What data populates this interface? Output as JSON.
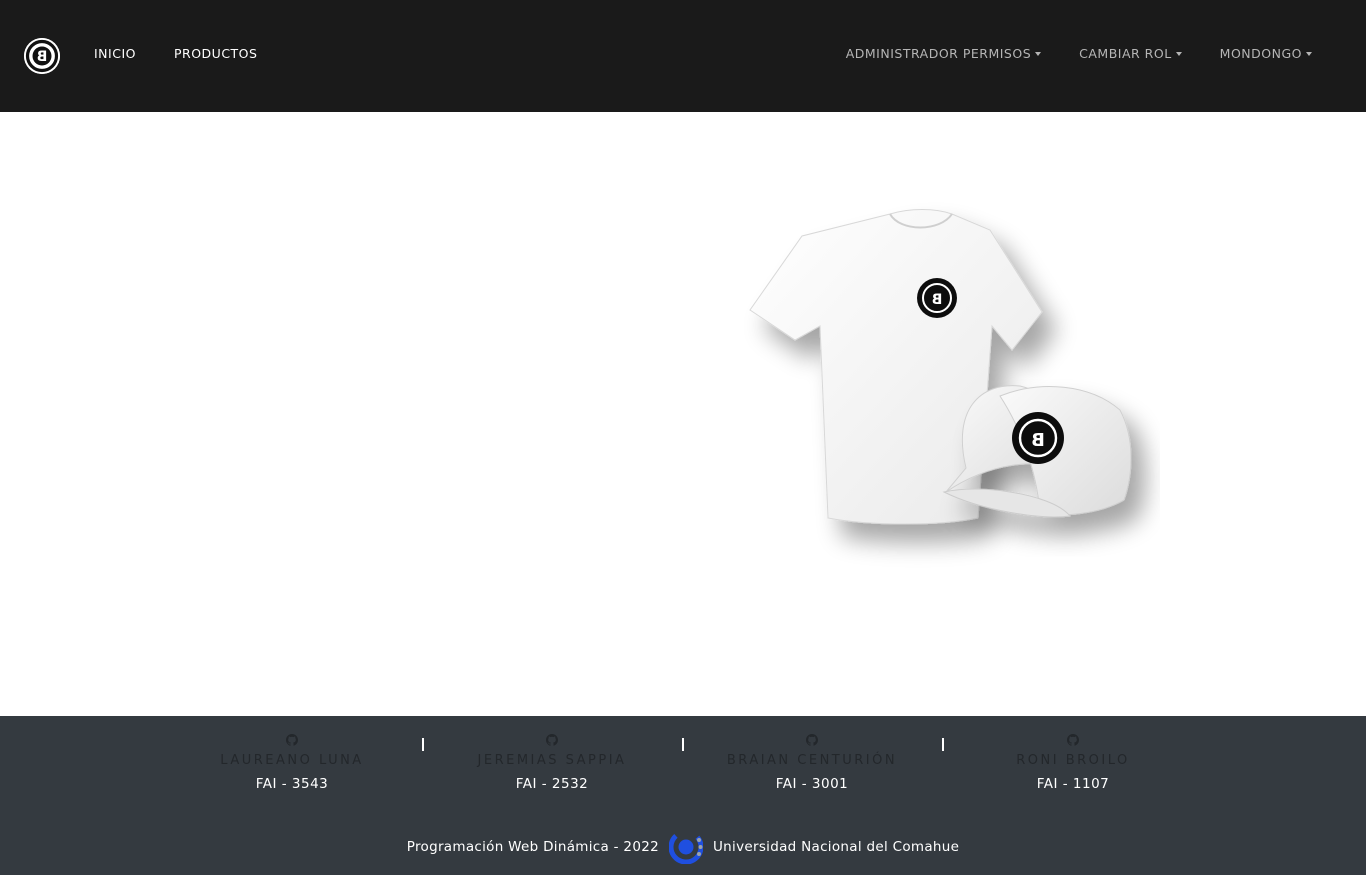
{
  "navbar": {
    "brand_icon": "brand-logo-icon",
    "left_links": [
      "INICIO",
      "PRODUCTOS"
    ],
    "right_menus": [
      "ADMINISTRADOR PERMISOS",
      "CAMBIAR ROL",
      "MONDONGO"
    ]
  },
  "hero": {
    "image": "tshirt-and-cap-product-image"
  },
  "footer": {
    "authors": [
      {
        "name": "LAUREANO LUNA",
        "fai": "FAI - 3543",
        "icon": "github-icon"
      },
      {
        "name": "JEREMIAS SAPPIA",
        "fai": "FAI - 2532",
        "icon": "github-icon"
      },
      {
        "name": "BRAIAN CENTURIÓN",
        "fai": "FAI - 3001",
        "icon": "github-icon"
      },
      {
        "name": "RONI BROILO",
        "fai": "FAI - 1107",
        "icon": "github-icon"
      }
    ],
    "separator": "|",
    "course": "Programación Web Dinámica - 2022",
    "university": "Universidad Nacional del Comahue",
    "university_icon": "unco-logo-icon"
  },
  "colors": {
    "navbar_bg": "#1a1a1a",
    "footer_bg": "#343a40",
    "accent_blue": "#1f4fe0"
  }
}
